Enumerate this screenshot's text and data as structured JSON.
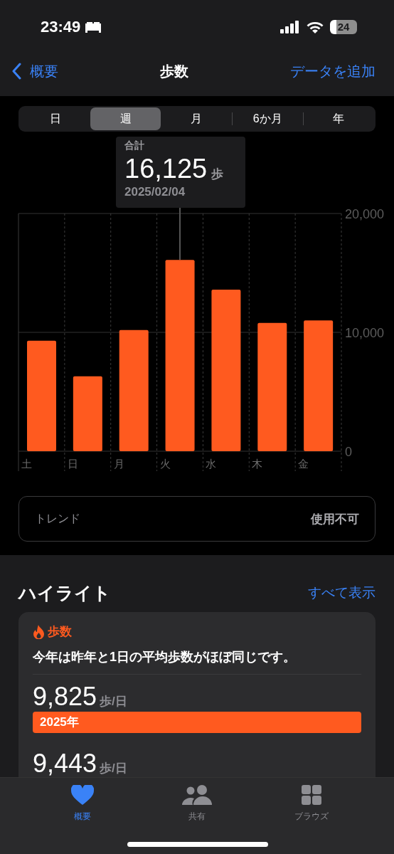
{
  "status_bar": {
    "time": "23:49",
    "battery": "24"
  },
  "nav": {
    "back": "概要",
    "title": "歩数",
    "action": "データを追加"
  },
  "periods": [
    {
      "label": "日",
      "selected": false
    },
    {
      "label": "週",
      "selected": true
    },
    {
      "label": "月",
      "selected": false
    },
    {
      "label": "6か月",
      "selected": false
    },
    {
      "label": "年",
      "selected": false
    }
  ],
  "tooltip": {
    "label": "合計",
    "value": "16,125",
    "unit": "歩",
    "date": "2025/02/04"
  },
  "chart_data": {
    "type": "bar",
    "categories": [
      "土",
      "日",
      "月",
      "火",
      "水",
      "木",
      "金"
    ],
    "series": [
      {
        "color": "#ff5a1f",
        "values": [
          9300,
          6300,
          10200,
          16100,
          13600,
          10800,
          11000
        ]
      }
    ],
    "ylim": [
      0,
      20000
    ],
    "yticks": [
      {
        "value": 0,
        "label": "0"
      },
      {
        "value": 10000,
        "label": "10,000"
      },
      {
        "value": 20000,
        "label": "20,000"
      }
    ]
  },
  "trend": {
    "label": "トレンド",
    "value": "使用不可"
  },
  "highlights": {
    "title": "ハイライト",
    "link": "すべて表示",
    "card": {
      "title": "歩数",
      "text": "今年は昨年と1日の平均歩数がほぼ同じです。",
      "comparisons": [
        {
          "value": "9,825",
          "unit": "歩/日",
          "label": "2025年"
        },
        {
          "value": "9,443",
          "unit": "歩/日"
        }
      ]
    }
  },
  "tab_bar": [
    {
      "kind": "heart",
      "label": "概要",
      "selected": true
    },
    {
      "kind": "people",
      "label": "共有",
      "selected": false
    },
    {
      "kind": "grid",
      "label": "ブラウズ",
      "selected": false
    }
  ]
}
